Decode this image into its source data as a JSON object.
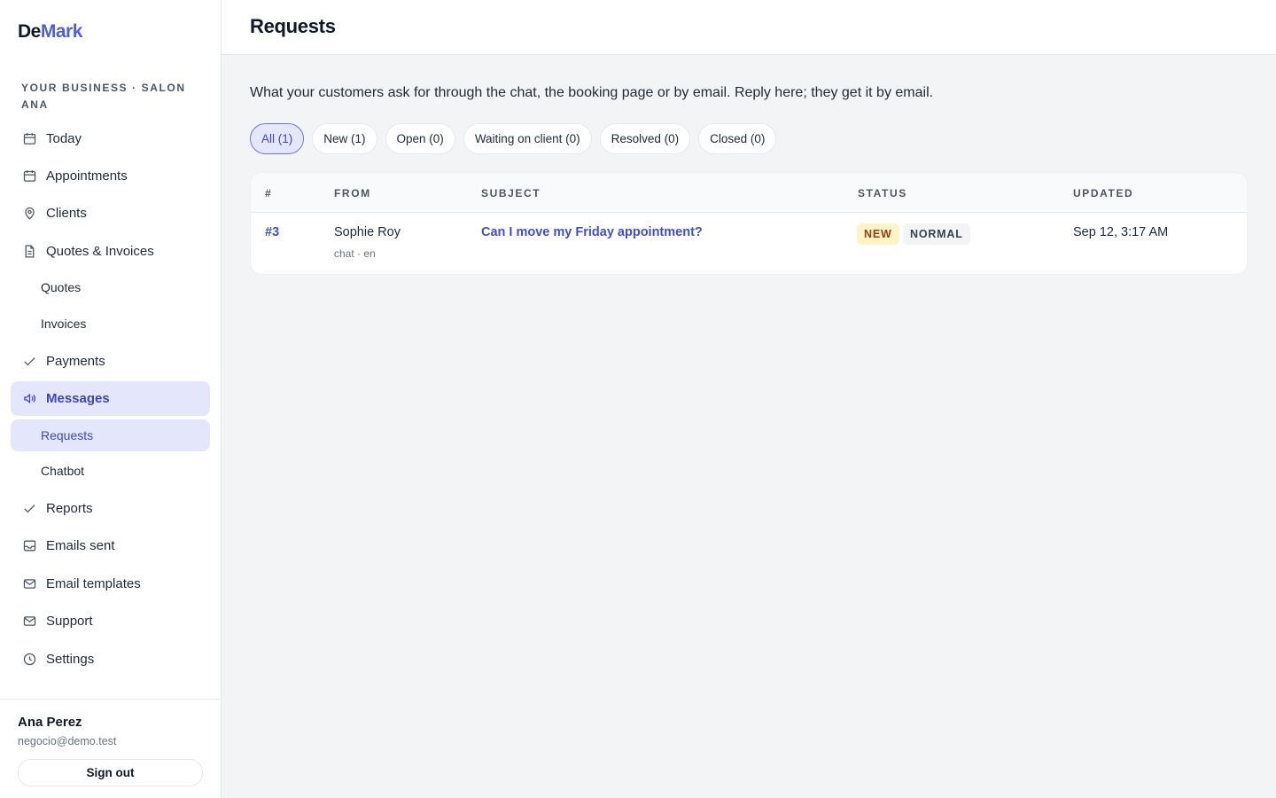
{
  "brand": {
    "part1": "De",
    "part2": "Mark"
  },
  "business_label": "YOUR BUSINESS · SALON ANA",
  "nav": {
    "today": "Today",
    "appointments": "Appointments",
    "clients": "Clients",
    "quotes_invoices": "Quotes & Invoices",
    "quotes": "Quotes",
    "invoices": "Invoices",
    "payments": "Payments",
    "messages": "Messages",
    "requests": "Requests",
    "chatbot": "Chatbot",
    "reports": "Reports",
    "emails_sent": "Emails sent",
    "email_templates": "Email templates",
    "support": "Support",
    "settings": "Settings"
  },
  "user": {
    "name": "Ana Perez",
    "email": "negocio@demo.test",
    "signout_label": "Sign out"
  },
  "page": {
    "title": "Requests",
    "intro": "What your customers ask for through the chat, the booking page or by email. Reply here; they get it by email."
  },
  "filters": [
    "All (1)",
    "New (1)",
    "Open (0)",
    "Waiting on client (0)",
    "Resolved (0)",
    "Closed (0)"
  ],
  "table": {
    "headers": {
      "num": "#",
      "from": "FROM",
      "subject": "SUBJECT",
      "status": "STATUS",
      "updated": "UPDATED"
    },
    "rows": [
      {
        "num": "#3",
        "from": "Sophie Roy",
        "channel": "chat · en",
        "subject": "Can I move my Friday appointment?",
        "status": "NEW",
        "priority": "NORMAL",
        "updated": "Sep 12, 3:17 AM"
      }
    ]
  },
  "colors": {
    "accent": "#4f5fd8",
    "active_bg": "#e4e7fb",
    "new_badge_bg": "#fef3c7",
    "new_badge_fg": "#92400e"
  }
}
